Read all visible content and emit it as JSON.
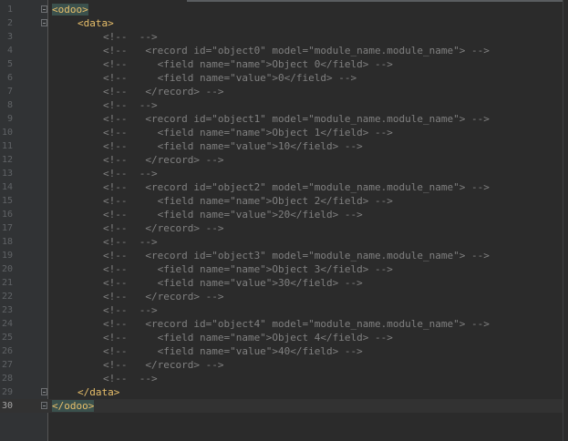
{
  "editor": {
    "current_line": 30,
    "lines": [
      {
        "n": "1",
        "text": "<odoo>",
        "kind": "tag",
        "highlight": true,
        "indent": 0,
        "fold": true
      },
      {
        "n": "2",
        "text": "<data>",
        "kind": "tag",
        "highlight": false,
        "indent": 1,
        "fold": true
      },
      {
        "n": "3",
        "text": "<!--  -->",
        "kind": "cmt",
        "indent": 2
      },
      {
        "n": "4",
        "text": "<!--   <record id=\"object0\" model=\"module_name.module_name\"> -->",
        "kind": "cmt",
        "indent": 2
      },
      {
        "n": "5",
        "text": "<!--     <field name=\"name\">Object 0</field> -->",
        "kind": "cmt",
        "indent": 2
      },
      {
        "n": "6",
        "text": "<!--     <field name=\"value\">0</field> -->",
        "kind": "cmt",
        "indent": 2
      },
      {
        "n": "7",
        "text": "<!--   </record> -->",
        "kind": "cmt",
        "indent": 2
      },
      {
        "n": "8",
        "text": "<!--  -->",
        "kind": "cmt",
        "indent": 2
      },
      {
        "n": "9",
        "text": "<!--   <record id=\"object1\" model=\"module_name.module_name\"> -->",
        "kind": "cmt",
        "indent": 2
      },
      {
        "n": "10",
        "text": "<!--     <field name=\"name\">Object 1</field> -->",
        "kind": "cmt",
        "indent": 2
      },
      {
        "n": "11",
        "text": "<!--     <field name=\"value\">10</field> -->",
        "kind": "cmt",
        "indent": 2
      },
      {
        "n": "12",
        "text": "<!--   </record> -->",
        "kind": "cmt",
        "indent": 2
      },
      {
        "n": "13",
        "text": "<!--  -->",
        "kind": "cmt",
        "indent": 2
      },
      {
        "n": "14",
        "text": "<!--   <record id=\"object2\" model=\"module_name.module_name\"> -->",
        "kind": "cmt",
        "indent": 2
      },
      {
        "n": "15",
        "text": "<!--     <field name=\"name\">Object 2</field> -->",
        "kind": "cmt",
        "indent": 2
      },
      {
        "n": "16",
        "text": "<!--     <field name=\"value\">20</field> -->",
        "kind": "cmt",
        "indent": 2
      },
      {
        "n": "17",
        "text": "<!--   </record> -->",
        "kind": "cmt",
        "indent": 2
      },
      {
        "n": "18",
        "text": "<!--  -->",
        "kind": "cmt",
        "indent": 2
      },
      {
        "n": "19",
        "text": "<!--   <record id=\"object3\" model=\"module_name.module_name\"> -->",
        "kind": "cmt",
        "indent": 2
      },
      {
        "n": "20",
        "text": "<!--     <field name=\"name\">Object 3</field> -->",
        "kind": "cmt",
        "indent": 2
      },
      {
        "n": "21",
        "text": "<!--     <field name=\"value\">30</field> -->",
        "kind": "cmt",
        "indent": 2
      },
      {
        "n": "22",
        "text": "<!--   </record> -->",
        "kind": "cmt",
        "indent": 2
      },
      {
        "n": "23",
        "text": "<!--  -->",
        "kind": "cmt",
        "indent": 2
      },
      {
        "n": "24",
        "text": "<!--   <record id=\"object4\" model=\"module_name.module_name\"> -->",
        "kind": "cmt",
        "indent": 2
      },
      {
        "n": "25",
        "text": "<!--     <field name=\"name\">Object 4</field> -->",
        "kind": "cmt",
        "indent": 2
      },
      {
        "n": "26",
        "text": "<!--     <field name=\"value\">40</field> -->",
        "kind": "cmt",
        "indent": 2
      },
      {
        "n": "27",
        "text": "<!--   </record> -->",
        "kind": "cmt",
        "indent": 2
      },
      {
        "n": "28",
        "text": "<!--  -->",
        "kind": "cmt",
        "indent": 2
      },
      {
        "n": "29",
        "text": "</data>",
        "kind": "tag",
        "highlight": false,
        "indent": 1,
        "fold": true
      },
      {
        "n": "30",
        "text": "</odoo>",
        "kind": "tag",
        "highlight": true,
        "indent": 0,
        "fold": true
      }
    ]
  },
  "colors": {
    "background": "#2b2b2b",
    "gutter": "#313335",
    "tag": "#e8bf6a",
    "comment": "#808080",
    "tag_match_highlight": "#3b514d",
    "current_line": "#323232"
  }
}
